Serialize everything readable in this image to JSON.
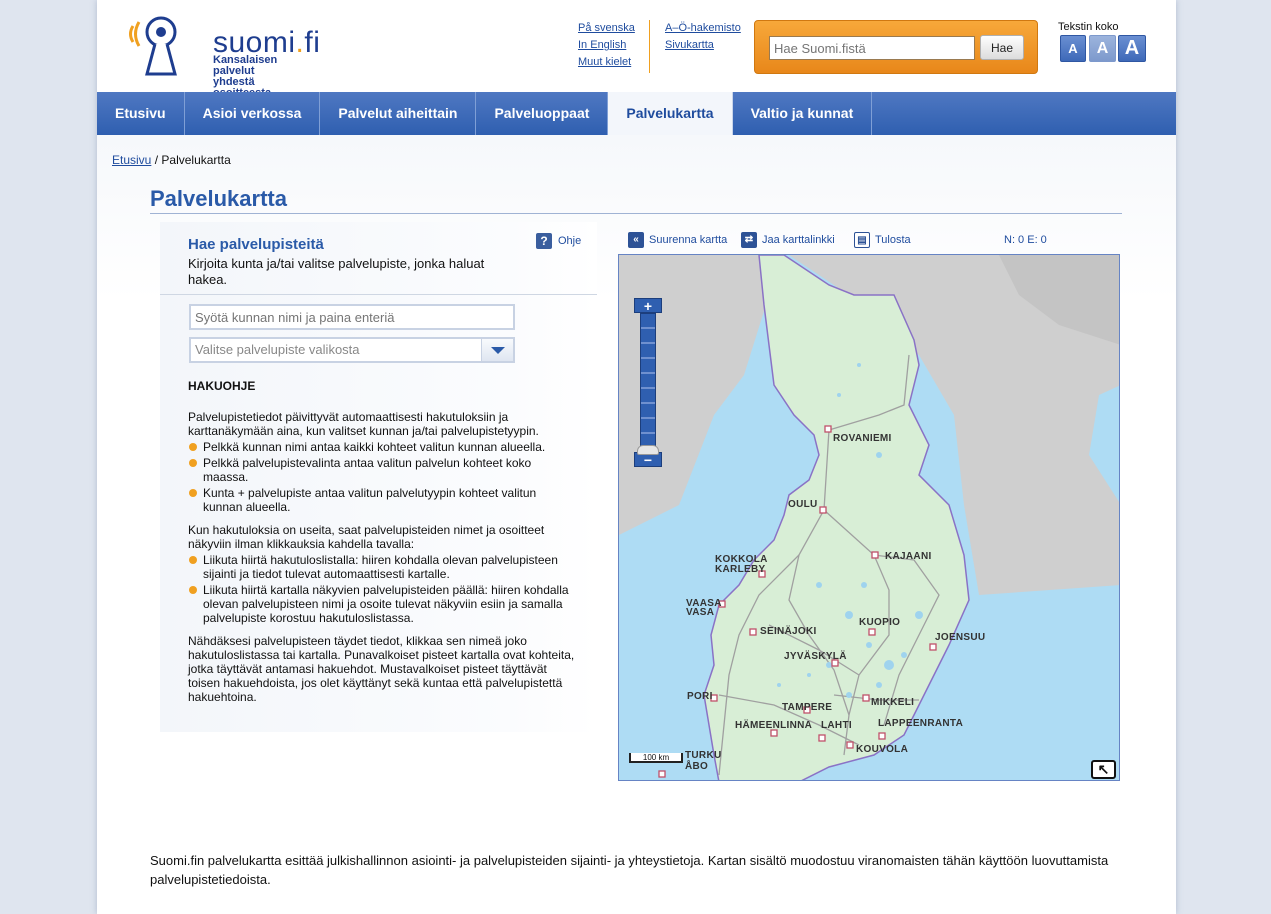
{
  "header": {
    "logo_text": "suomi",
    "logo_dot": ".",
    "logo_tld": "fi",
    "logo_sub1": "Kansalaisen palvelut",
    "logo_sub2": "yhdestä osoitteesta",
    "lang_links": [
      "På svenska",
      "In English",
      "Muut kielet"
    ],
    "util_links": [
      "A–Ö-hakemisto",
      "Sivukartta"
    ],
    "search_placeholder": "Hae Suomi.fistä",
    "search_button": "Hae",
    "textsize_label": "Tekstin koko",
    "textsize_buttons": [
      "A",
      "A",
      "A"
    ]
  },
  "nav": [
    "Etusivu",
    "Asioi verkossa",
    "Palvelut aiheittain",
    "Palveluoppaat",
    "Palvelukartta",
    "Valtio ja kunnat"
  ],
  "nav_active": "Palvelukartta",
  "breadcrumb": {
    "home": "Etusivu",
    "sep": "/",
    "current": "Palvelukartta"
  },
  "page_title": "Palvelukartta",
  "panel": {
    "heading": "Hae palvelupisteitä",
    "help": "Ohje",
    "intro": "Kirjoita kunta ja/tai valitse palvelupiste, jonka haluat hakea.",
    "municipality_placeholder": "Syötä kunnan nimi ja paina enteriä",
    "service_placeholder": "Valitse palvelupiste valikosta",
    "howto_title": "HAKUOHJE",
    "p1": "Palvelupistetiedot päivittyvät automaattisesti hakutuloksiin ja karttanäkymään aina, kun valitset kunnan ja/tai palvelupistetyypin.",
    "list1": [
      "Pelkkä kunnan nimi antaa kaikki kohteet valitun kunnan alueella.",
      "Pelkkä palvelupistevalinta antaa valitun palvelun kohteet koko maassa.",
      "Kunta + palvelupiste antaa valitun palvelutyypin kohteet valitun kunnan alueella."
    ],
    "p2": "Kun hakutuloksia on useita, saat palvelupisteiden nimet ja osoitteet näkyviin ilman klikkauksia kahdella tavalla:",
    "list2": [
      "Liikuta hiirtä hakutuloslistalla: hiiren kohdalla olevan palvelupisteen sijainti ja tiedot tulevat automaattisesti kartalle.",
      "Liikuta hiirtä kartalla näkyvien palvelupisteiden päällä: hiiren kohdalla olevan palvelupisteen nimi ja osoite tulevat näkyviin esiin ja samalla palvelupiste korostuu hakutuloslistassa."
    ],
    "p3": "Nähdäksesi palvelupisteen täydet tiedot, klikkaa sen nimeä joko hakutuloslistassa tai kartalla. Punavalkoiset pisteet kartalla ovat kohteita, jotka täyttävät antamasi hakuehdot. Mustavalkoiset pisteet täyttävät toisen hakuehdoista, jos olet käyttänyt sekä kuntaa että palvelupistettä hakuehtoina."
  },
  "map_tools": {
    "enlarge": "Suurenna kartta",
    "share": "Jaa karttalinkki",
    "print": "Tulosta",
    "coords": "N: 0 E: 0"
  },
  "map": {
    "zoom_in": "+",
    "zoom_out": "−",
    "scale": "100 km",
    "cities": [
      "ROVANIEMI",
      "OULU",
      "KAJAANI",
      "KOKKOLA",
      "KARLEBY",
      "VAASA",
      "VASA",
      "SEINÄJOKI",
      "KUOPIO",
      "JOENSUU",
      "JYVÄSKYLÄ",
      "PORI",
      "TAMPERE",
      "MIKKELI",
      "HÄMEENLINNA",
      "LAHTI",
      "LAPPEENRANTA",
      "KOUVOLA",
      "TURKU",
      "ÅBO"
    ]
  },
  "footer": "Suomi.fin palvelukartta esittää julkishallinnon asiointi- ja palvelupisteiden sijainti- ja yhteystietoja. Kartan sisältö muodostuu viranomaisten tähän käyttöön luovuttamista palvelupistetiedoista."
}
